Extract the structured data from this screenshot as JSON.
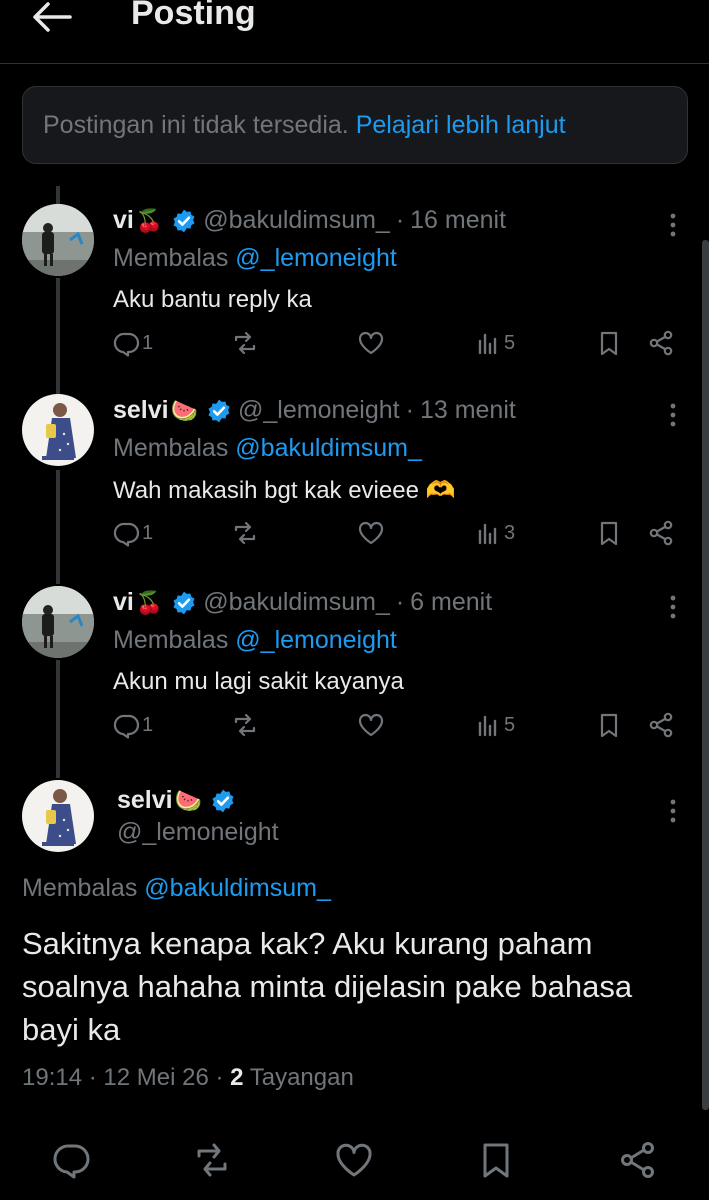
{
  "header": {
    "title": "Posting"
  },
  "notice": {
    "text": "Postingan ini tidak tersedia.",
    "link": "Pelajari lebih lanjut"
  },
  "replies": [
    {
      "name": "vi",
      "emoji": "🍒",
      "handle": "@bakuldimsum_",
      "time": "16 menit",
      "reply_label": "Membalas",
      "reply_to": "@_lemoneight",
      "text": "Aku bantu reply ka",
      "reply_count": "1",
      "view_count": "5"
    },
    {
      "name": "selvi",
      "emoji": "🍉",
      "handle": "@_lemoneight",
      "time": "13 menit",
      "reply_label": "Membalas",
      "reply_to": "@bakuldimsum_",
      "text": "Wah makasih bgt kak evieee 🫶",
      "reply_count": "1",
      "view_count": "3"
    },
    {
      "name": "vi",
      "emoji": "🍒",
      "handle": "@bakuldimsum_",
      "time": "6 menit",
      "reply_label": "Membalas",
      "reply_to": "@_lemoneight",
      "text": "Akun mu lagi sakit kayanya",
      "reply_count": "1",
      "view_count": "5"
    }
  ],
  "main_post": {
    "name": "selvi",
    "emoji": "🍉",
    "handle": "@_lemoneight",
    "reply_label": "Membalas",
    "reply_to": "@bakuldimsum_",
    "text": "Sakitnya kenapa kak? Aku kurang paham soalnya hahaha minta dijelasin pake bahasa bayi ka",
    "time": "19:14",
    "date": "12 Mei 26",
    "views": "2",
    "views_label": "Tayangan"
  },
  "colors": {
    "accent": "#1d9bf0",
    "muted": "#71767b",
    "text": "#e7e9ea",
    "background": "#000000"
  }
}
